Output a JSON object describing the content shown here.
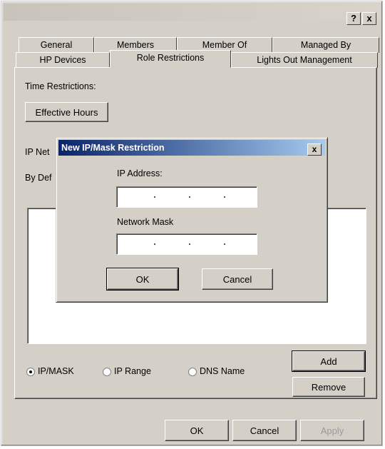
{
  "titlebar": {
    "help": "?",
    "close": "x"
  },
  "tabs_row1": [
    "General",
    "Members",
    "Member Of",
    "Managed By"
  ],
  "tabs_row2": [
    "HP Devices",
    "Role Restrictions",
    "Lights Out Management"
  ],
  "time_restrictions": {
    "label": "Time Restrictions:",
    "button": "Effective Hours"
  },
  "ip_label_partial": "IP Net",
  "by_default_partial": "By Def",
  "radios": [
    {
      "label": "IP/MASK",
      "checked": true
    },
    {
      "label": "IP Range",
      "checked": false
    },
    {
      "label": "DNS Name",
      "checked": false
    }
  ],
  "side_buttons": {
    "add": "Add",
    "remove": "Remove"
  },
  "bottom_buttons": {
    "ok": "OK",
    "cancel": "Cancel",
    "apply": "Apply"
  },
  "dialog": {
    "title": "New IP/Mask Restriction",
    "close": "x",
    "ip_label": "IP Address:",
    "mask_label": "Network Mask",
    "ok": "OK",
    "cancel": "Cancel"
  }
}
